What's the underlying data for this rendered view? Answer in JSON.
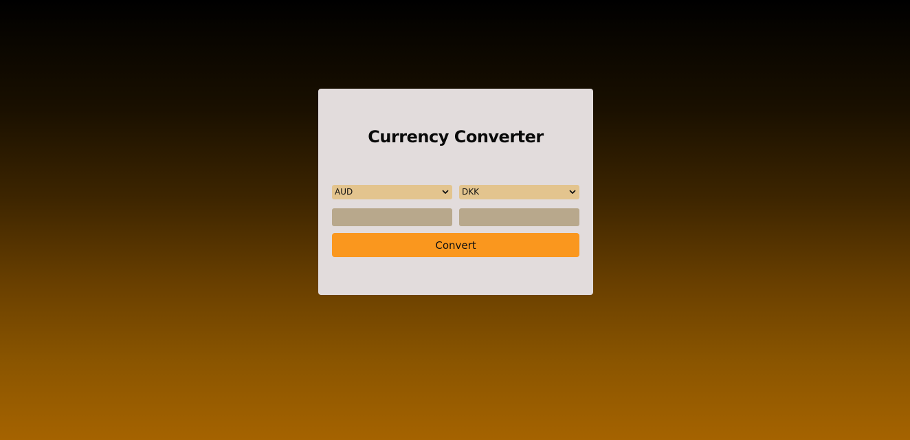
{
  "converter": {
    "title": "Currency Converter",
    "from_currency": "AUD",
    "to_currency": "DKK",
    "from_amount": "",
    "to_amount": "",
    "convert_label": "Convert"
  },
  "colors": {
    "card_bg": "#e2dcdc",
    "select_bg": "#e3c48e",
    "input_bg": "#b8a88c",
    "button_bg": "#fa971e"
  },
  "icons": {
    "select_arrow": "chevron-down-icon"
  }
}
